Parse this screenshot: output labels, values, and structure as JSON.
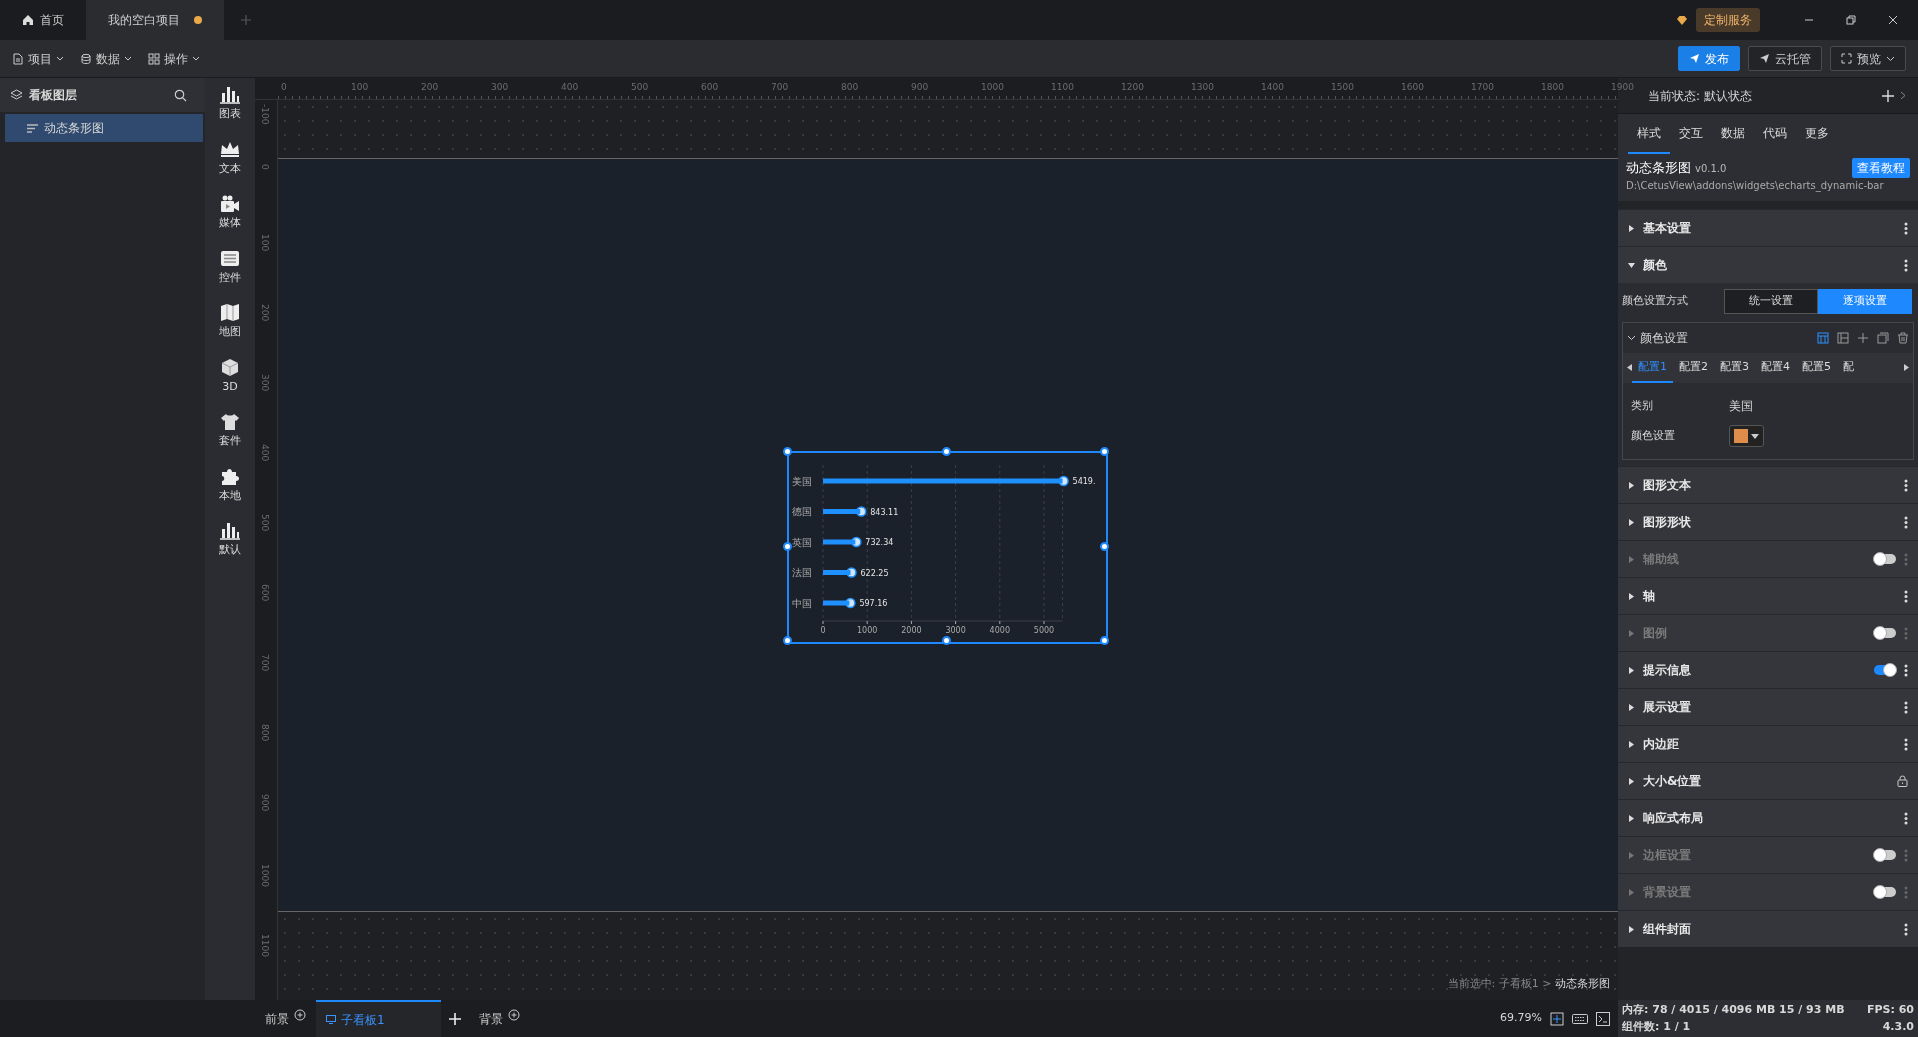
{
  "title_tabs": [
    {
      "label": "首页",
      "selected": false,
      "modified": false
    },
    {
      "label": "我的空白项目",
      "selected": true,
      "modified": true
    }
  ],
  "custom_service": "定制服务",
  "menus": [
    {
      "label": "项目"
    },
    {
      "label": "数据"
    },
    {
      "label": "操作"
    }
  ],
  "actions": [
    {
      "label": "发布",
      "kind": "primary"
    },
    {
      "label": "云托管",
      "kind": "outline"
    },
    {
      "label": "预览",
      "kind": "dropdown"
    }
  ],
  "layers": {
    "title": "看板图层",
    "items": [
      {
        "label": "动态条形图",
        "selected": true
      }
    ]
  },
  "toolbox": [
    {
      "label": "图表"
    },
    {
      "label": "文本"
    },
    {
      "label": "媒体"
    },
    {
      "label": "控件"
    },
    {
      "label": "地图"
    },
    {
      "label": "3D"
    },
    {
      "label": "套件"
    },
    {
      "label": "本地"
    },
    {
      "label": "默认"
    }
  ],
  "ruler": {
    "h_labels": [
      "0",
      "100",
      "200",
      "300",
      "400",
      "500",
      "600",
      "700",
      "800",
      "900",
      "1000",
      "1100",
      "1200",
      "1300",
      "1400",
      "1500",
      "1600",
      "1700",
      "1800",
      "1900"
    ],
    "v_labels": [
      "-100",
      "0",
      "100",
      "200",
      "300",
      "400",
      "500",
      "600",
      "700",
      "800",
      "900",
      "1000",
      "1100"
    ]
  },
  "canvas": {
    "chart_data": {
      "type": "bar",
      "orientation": "horizontal",
      "categories": [
        "美国",
        "德国",
        "英国",
        "法国",
        "中国"
      ],
      "series": [
        {
          "color": "#1e90ff",
          "values": [
            5420,
            843,
            732,
            622,
            597
          ]
        }
      ],
      "grid": true,
      "value_labels": [
        "5419.",
        "843.11",
        "732.34",
        "622.25",
        "597.16"
      ],
      "xticks": [
        0,
        1000,
        2000,
        3000,
        4000,
        5000
      ],
      "xlim": [
        0,
        5420
      ]
    },
    "breadcrumb_prefix": "当前选中: 子看板1 >",
    "breadcrumb_current": "动态条形图"
  },
  "boards": [
    {
      "label": "前景",
      "kind": "layer",
      "selected": false
    },
    {
      "label": "子看板1",
      "kind": "board",
      "selected": true
    },
    {
      "label": "背景",
      "kind": "layer",
      "selected": false
    }
  ],
  "zoom": "69.79%",
  "inspector": {
    "state_label": "当前状态:",
    "state": "默认状态",
    "tabs": [
      {
        "label": "样式",
        "selected": true
      },
      {
        "label": "交互",
        "selected": false
      },
      {
        "label": "数据",
        "selected": false
      },
      {
        "label": "代码",
        "selected": false
      },
      {
        "label": "更多",
        "selected": false
      }
    ],
    "widget": {
      "name": "动态条形图",
      "version": "v0.1.0",
      "tutorial": "查看教程",
      "path": "D:\\CetusView\\addons\\widgets\\echarts_dynamic-bar"
    },
    "sections": [
      {
        "title": "基本设置",
        "expanded": false,
        "locked": false
      },
      {
        "title": "颜色",
        "expanded": true,
        "locked": false
      },
      {
        "title": "图形文本",
        "expanded": false,
        "locked": false
      },
      {
        "title": "图形形状",
        "expanded": false,
        "locked": false
      },
      {
        "title": "辅助线",
        "expanded": false,
        "locked": false,
        "on": false
      },
      {
        "title": "轴",
        "expanded": false,
        "locked": false
      },
      {
        "title": "图例",
        "expanded": false,
        "locked": false,
        "on": false
      },
      {
        "title": "提示信息",
        "expanded": false,
        "locked": false,
        "on": true
      },
      {
        "title": "展示设置",
        "expanded": false,
        "locked": false
      },
      {
        "title": "内边距",
        "expanded": false,
        "locked": false
      },
      {
        "title": "大小&位置",
        "expanded": false,
        "locked": true
      },
      {
        "title": "响应式布局",
        "expanded": false,
        "locked": false
      },
      {
        "title": "边框设置",
        "expanded": false,
        "locked": false,
        "on": false
      },
      {
        "title": "背景设置",
        "expanded": false,
        "locked": false,
        "on": false
      },
      {
        "title": "组件封面",
        "expanded": false,
        "locked": false
      }
    ],
    "color": {
      "mode_label": "颜色设置方式",
      "modes": [
        {
          "label": "统一设置",
          "selected": false
        },
        {
          "label": "逐项设置",
          "selected": true
        }
      ],
      "group": {
        "title": "颜色设置",
        "expanded": true,
        "tools": [
          {
            "selected": true
          },
          {
            "selected": false
          },
          {
            "selected": false
          },
          {
            "selected": false
          },
          {
            "selected": false
          }
        ],
        "tabs": [
          {
            "label": "配置1",
            "selected": true
          },
          {
            "label": "配置2",
            "selected": false
          },
          {
            "label": "配置3",
            "selected": false
          },
          {
            "label": "配置4",
            "selected": false
          },
          {
            "label": "配置5",
            "selected": false
          },
          {
            "label": "配",
            "selected": false
          }
        ],
        "fields": [
          {
            "label": "类别",
            "kind": "text",
            "value": "美国"
          },
          {
            "label": "颜色设置",
            "kind": "color",
            "color": "#e08c4a"
          }
        ]
      }
    }
  },
  "status": {
    "memory": "内存: 78 / 4015 / 4096 MB  15 / 93 MB",
    "fps": "FPS: 60",
    "components": "组件数: 1 / 1",
    "version": "4.3.0"
  }
}
